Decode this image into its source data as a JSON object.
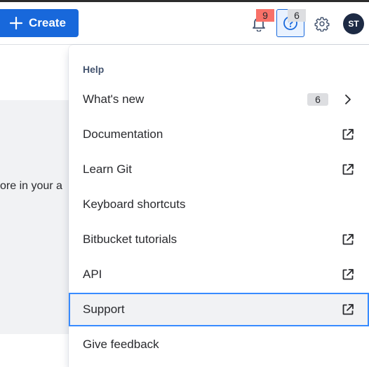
{
  "header": {
    "create_label": "Create",
    "notifications_count": "9",
    "help_count": "6",
    "avatar_initials": "ST",
    "icons": {
      "create": "plus-icon",
      "notifications": "bell-icon",
      "help": "question-icon",
      "settings": "gear-icon"
    }
  },
  "background": {
    "partial_text": "ore in your a"
  },
  "help_menu": {
    "heading": "Help",
    "items": [
      {
        "label": "What's new",
        "badge": "6",
        "trailing_icon": "chevron-right-icon"
      },
      {
        "label": "Documentation",
        "trailing_icon": "external-link-icon"
      },
      {
        "label": "Learn Git",
        "trailing_icon": "external-link-icon"
      },
      {
        "label": "Keyboard shortcuts"
      },
      {
        "label": "Bitbucket tutorials",
        "trailing_icon": "external-link-icon"
      },
      {
        "label": "API",
        "trailing_icon": "external-link-icon"
      },
      {
        "label": "Support",
        "trailing_icon": "external-link-icon",
        "selected": true
      },
      {
        "label": "Give feedback"
      }
    ]
  },
  "colors": {
    "primary": "#1868db",
    "focus_ring": "#388bff",
    "notification_badge": "#f87168",
    "neutral_badge": "#dddee1",
    "avatar_bg": "#1d2a44"
  }
}
